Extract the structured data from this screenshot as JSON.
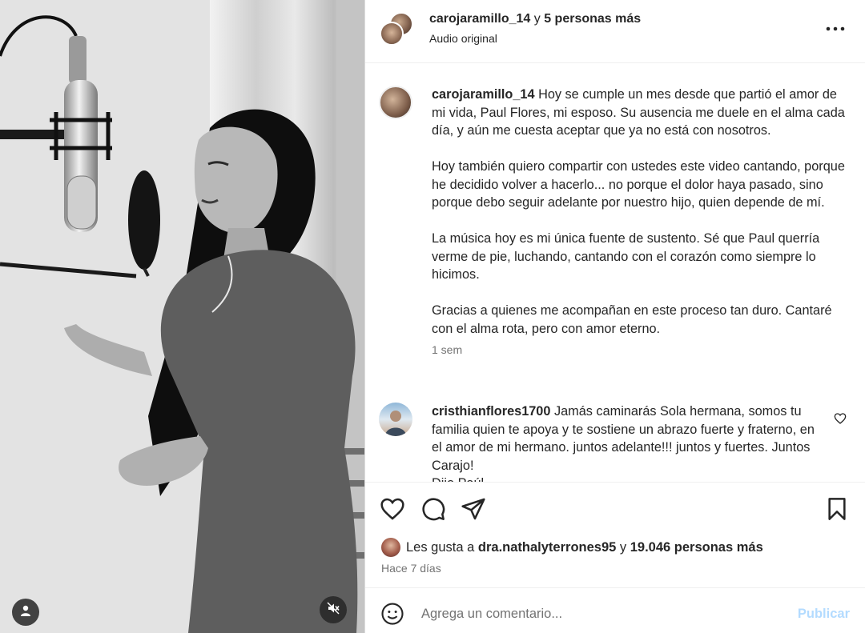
{
  "post": {
    "author": "carojaramillo_14",
    "header_connector": "y",
    "coauthors": "5 personas más",
    "audio": "Audio original"
  },
  "caption": {
    "username": "carojaramillo_14",
    "paragraphs": [
      "Hoy se cumple un mes desde que partió el amor de mi vida, Paul Flores, mi esposo. Su ausencia me duele en el alma cada día, y aún me cuesta aceptar que ya no está con nosotros.",
      "Hoy también quiero compartir con ustedes este video cantando, porque he decidido volver a hacerlo... no porque el dolor haya pasado, sino porque debo seguir adelante por nuestro hijo, quien depende de mí.",
      "La música hoy es mi única fuente de sustento. Sé que Paul querría verme de pie, luchando, cantando con el corazón como siempre lo hicimos.",
      "Gracias a quienes me acompañan en este proceso tan duro. Cantaré con el alma rota, pero con amor eterno."
    ],
    "time": "1 sem"
  },
  "comments": [
    {
      "username": "cristhianflores1700",
      "text": "Jamás caminarás Sola hermana, somos tu familia quien te apoya y te sostiene un abrazo fuerte y fraterno, en el amor de mi hermano. juntos adelante!!! juntos y fuertes. Juntos Carajo!",
      "text_cut": "Dijo Paúl..."
    }
  ],
  "likes": {
    "prefix": "Les gusta a",
    "user": "dra.nathalyterrones95",
    "connector": "y",
    "others": "19.046 personas más"
  },
  "post_time": "Hace 7 días",
  "composer": {
    "placeholder": "Agrega un comentario...",
    "publish": "Publicar"
  },
  "colors": {
    "accent_disabled": "#b3dbff",
    "secondary_text": "#737373",
    "divider": "#efefef"
  },
  "icons": [
    "more-options-icon",
    "heart-icon",
    "comment-icon",
    "share-icon",
    "bookmark-icon",
    "emoji-icon",
    "user-tag-icon",
    "muted-speaker-icon"
  ]
}
